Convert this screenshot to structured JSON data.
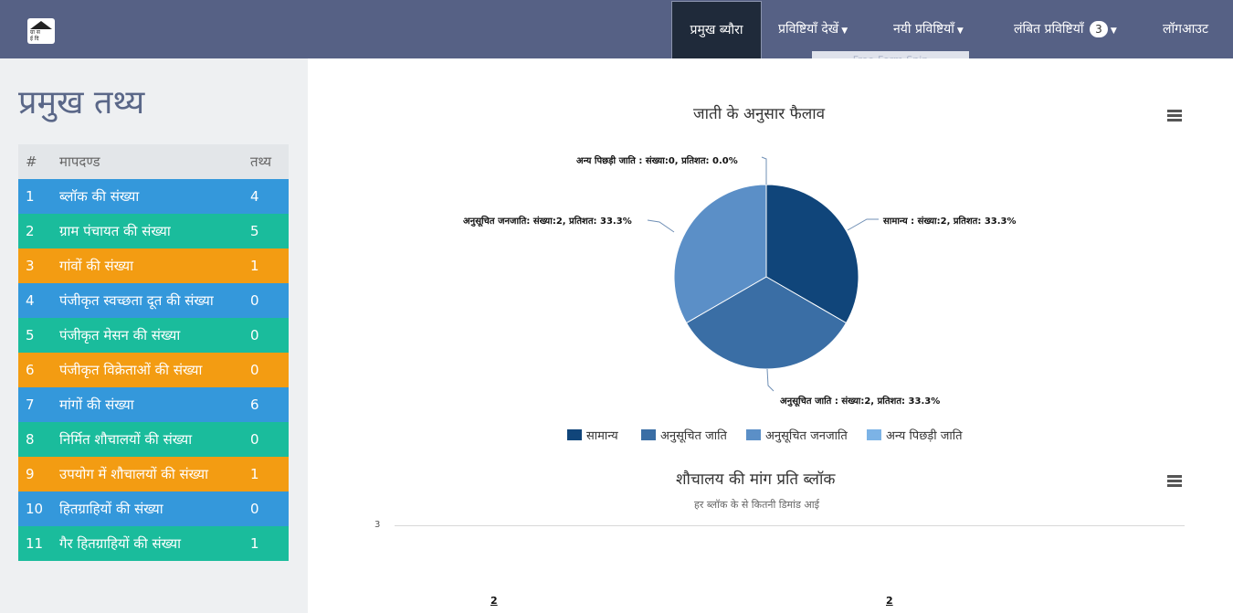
{
  "navbar": {
    "logo_text_1": "ग्रा स",
    "logo_text_2": "ई दि",
    "items": [
      {
        "label": "प्रमुख ब्यौरा",
        "active": true
      },
      {
        "label": "प्रविष्टियाँ देखें",
        "caret": true
      },
      {
        "label": "नयी प्रविष्टियाँ",
        "caret": true
      },
      {
        "label": "लंबित प्रविष्टियाँ",
        "caret": true,
        "badge": "3"
      },
      {
        "label": "लॉगआउट"
      }
    ],
    "ghost_tab": "Free-Form Snip"
  },
  "sidebar": {
    "title": "प्रमुख तथ्य",
    "headers": {
      "num": "#",
      "name": "मापदण्ड",
      "value": "तथ्य"
    },
    "rows": [
      {
        "num": "1",
        "name": "ब्लॉक की संख्या",
        "value": "4",
        "color": "#3498db"
      },
      {
        "num": "2",
        "name": "ग्राम पंचायत की संख्या",
        "value": "5",
        "color": "#1abc9c"
      },
      {
        "num": "3",
        "name": "गांवों की संख्या",
        "value": "1",
        "color": "#f39c12"
      },
      {
        "num": "4",
        "name": "पंजीकृत स्वच्छता दूत की संख्या",
        "value": "0",
        "color": "#3498db"
      },
      {
        "num": "5",
        "name": "पंजीकृत मेसन की संख्या",
        "value": "0",
        "color": "#1abc9c"
      },
      {
        "num": "6",
        "name": "पंजीकृत विक्रेताओं की संख्या",
        "value": "0",
        "color": "#f39c12"
      },
      {
        "num": "7",
        "name": "मांगों की संख्या",
        "value": "6",
        "color": "#3498db"
      },
      {
        "num": "8",
        "name": "निर्मित शौचालयों की संख्या",
        "value": "0",
        "color": "#1abc9c"
      },
      {
        "num": "9",
        "name": "उपयोग में शौचालयों की संख्या",
        "value": "1",
        "color": "#f39c12"
      },
      {
        "num": "10",
        "name": "हितग्राहियों की संख्या",
        "value": "0",
        "color": "#3498db"
      },
      {
        "num": "11",
        "name": "गैर हितग्राहियों की संख्या",
        "value": "1",
        "color": "#1abc9c"
      }
    ]
  },
  "pie_chart": {
    "title": "जाती के अनुसार फैलाव",
    "labels": {
      "general": "सामान्य : संख्या:2, प्रतिशत: 33.3%",
      "sc": "अनुसूचित जाति : संख्या:2, प्रतिशत: 33.3%",
      "st": "अनुसूचित जनजाति: संख्या:2, प्रतिशत: 33.3%",
      "obc": "अन्य पिछड़ी जाति : संख्या:0, प्रतिशत: 0.0%"
    }
  },
  "bar_chart": {
    "title": "शौचालय की मांग प्रति ब्लॉक",
    "subtitle": "हर ब्लॉक के से कितनी डिमांड आई",
    "y_top_tick": "3",
    "bar_labels": [
      "2",
      "2"
    ]
  },
  "chart_data": [
    {
      "type": "pie",
      "title": "जाती के अनुसार फैलाव",
      "categories": [
        "सामान्य",
        "अनुसूचित जाति",
        "अनुसूचित जनजाति",
        "अन्य पिछड़ी जाति"
      ],
      "values": [
        2,
        2,
        2,
        0
      ],
      "percentages": [
        33.3,
        33.3,
        33.3,
        0.0
      ],
      "colors": [
        "#10457a",
        "#3a6ea5",
        "#5b8fc7",
        "#7cb3e6"
      ],
      "legend_position": "bottom"
    },
    {
      "type": "bar",
      "title": "शौचालय की मांग प्रति ब्लॉक",
      "subtitle": "हर ब्लॉक के से कितनी डिमांड आई",
      "values": [
        2,
        2
      ],
      "ylim": [
        0,
        3
      ]
    }
  ]
}
